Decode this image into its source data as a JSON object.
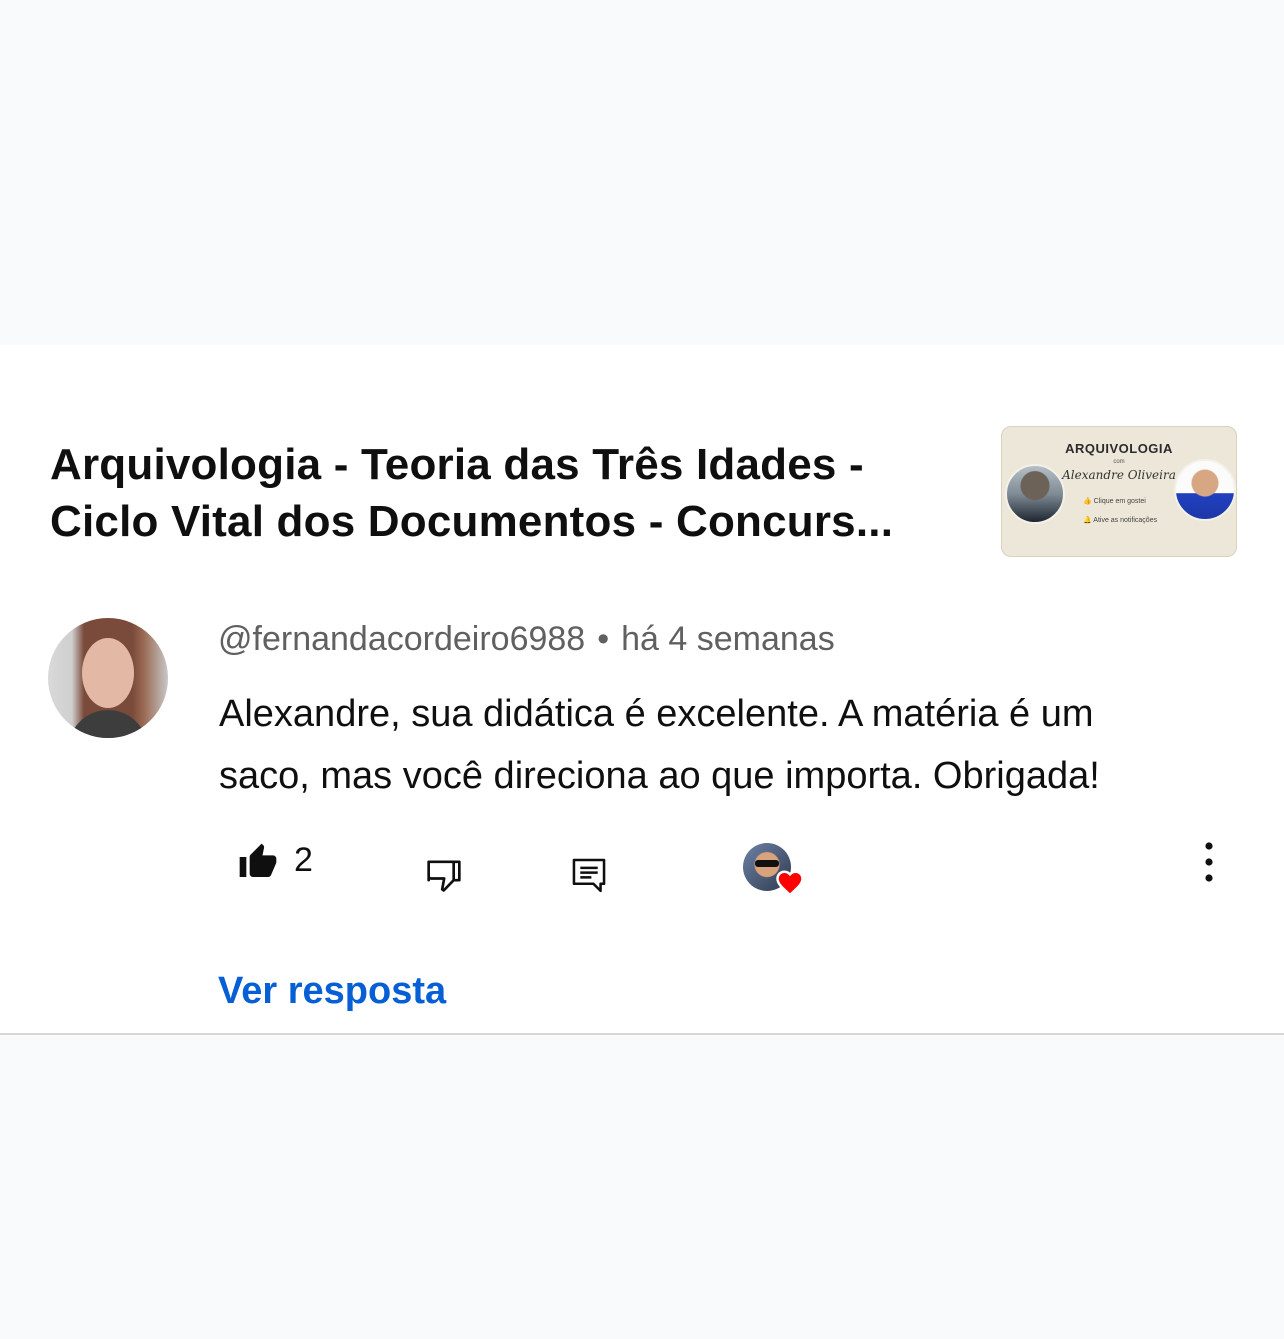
{
  "video": {
    "title": "Arquivologia - Teoria das Três Idades - Ciclo Vital dos Documentos - Concurs...",
    "thumbnail": {
      "brand": "ARQUIVOLOGIA",
      "com": "com",
      "name": "Alexandre Oliveira",
      "line1": "Clique em gostei",
      "line2": "Ative as notificações"
    }
  },
  "comment": {
    "author": "@fernandacordeiro6988",
    "separator": "•",
    "time": "há 4 semanas",
    "text_lines": [
      "Alexandre, sua didática é excelente. A matéria é um",
      "saco, mas você direciona ao que importa. Obrigada!"
    ],
    "like_count": "2",
    "liked": true,
    "creator_hearted": true
  },
  "actions": {
    "view_replies": "Ver resposta"
  },
  "icons": {
    "like": "thumb-up-filled-icon",
    "dislike": "thumb-down-outline-icon",
    "reply": "comment-reply-icon",
    "more": "more-vertical-icon",
    "heart": "heart-icon"
  },
  "colors": {
    "link": "#065fd4",
    "heart": "#ff0000",
    "meta_text": "#606060"
  }
}
